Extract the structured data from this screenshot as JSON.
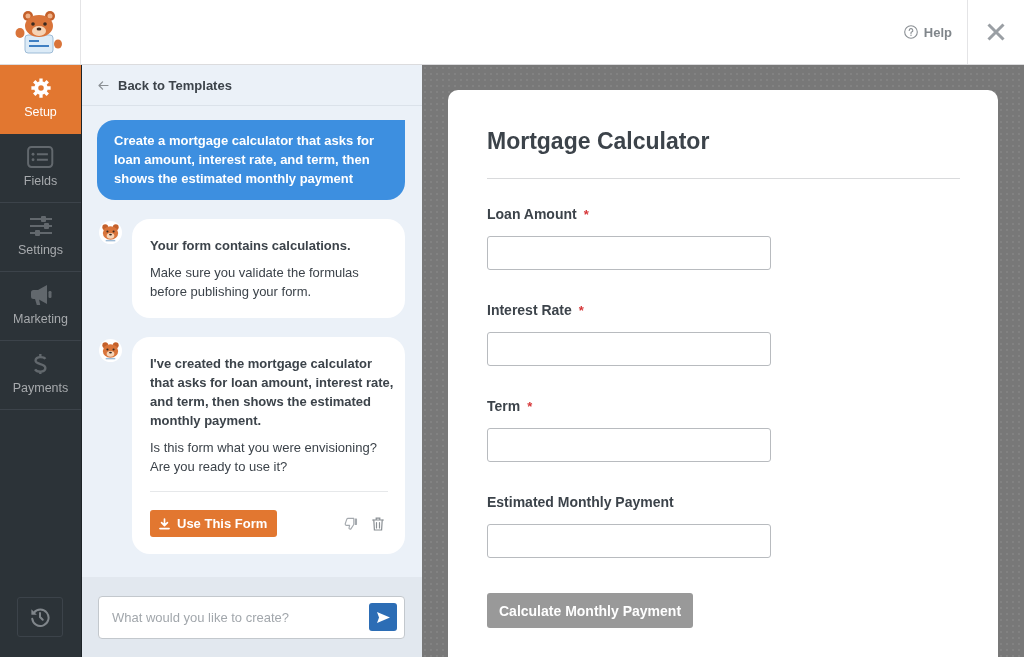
{
  "top_bar": {
    "help_label": "Help"
  },
  "sidebar": {
    "items": [
      {
        "label": "Setup",
        "selected": true
      },
      {
        "label": "Fields",
        "selected": false
      },
      {
        "label": "Settings",
        "selected": false
      },
      {
        "label": "Marketing",
        "selected": false
      },
      {
        "label": "Payments",
        "selected": false
      }
    ]
  },
  "chat": {
    "back_link": "Back to Templates",
    "messages": [
      {
        "kind": "prompt",
        "text": "Create a mortgage calculator that asks for loan amount, interest rate, and term, then shows the estimated monthly payment"
      },
      {
        "kind": "reply",
        "title": "Your form contains calculations.",
        "text": "Make sure you validate the formulas before publishing your form."
      },
      {
        "kind": "reply",
        "title": "I've created the mortgage calculator that asks for loan amount, interest rate, and term, then shows the estimated monthly payment.",
        "text": "Is this form what you were envisioning? Are you ready to use it?",
        "action": "Use This Form"
      }
    ],
    "input": {
      "placeholder": "What would you like to create?"
    }
  },
  "form": {
    "title": "Mortgage Calculator",
    "fields": [
      {
        "label": "Loan Amount",
        "required_mark": "*"
      },
      {
        "label": "Interest Rate",
        "required_mark": "*"
      },
      {
        "label": "Term",
        "required_mark": "*"
      },
      {
        "label": "Estimated Monthly Payment"
      }
    ],
    "submit_label": "Calculate Monthly Payment"
  }
}
